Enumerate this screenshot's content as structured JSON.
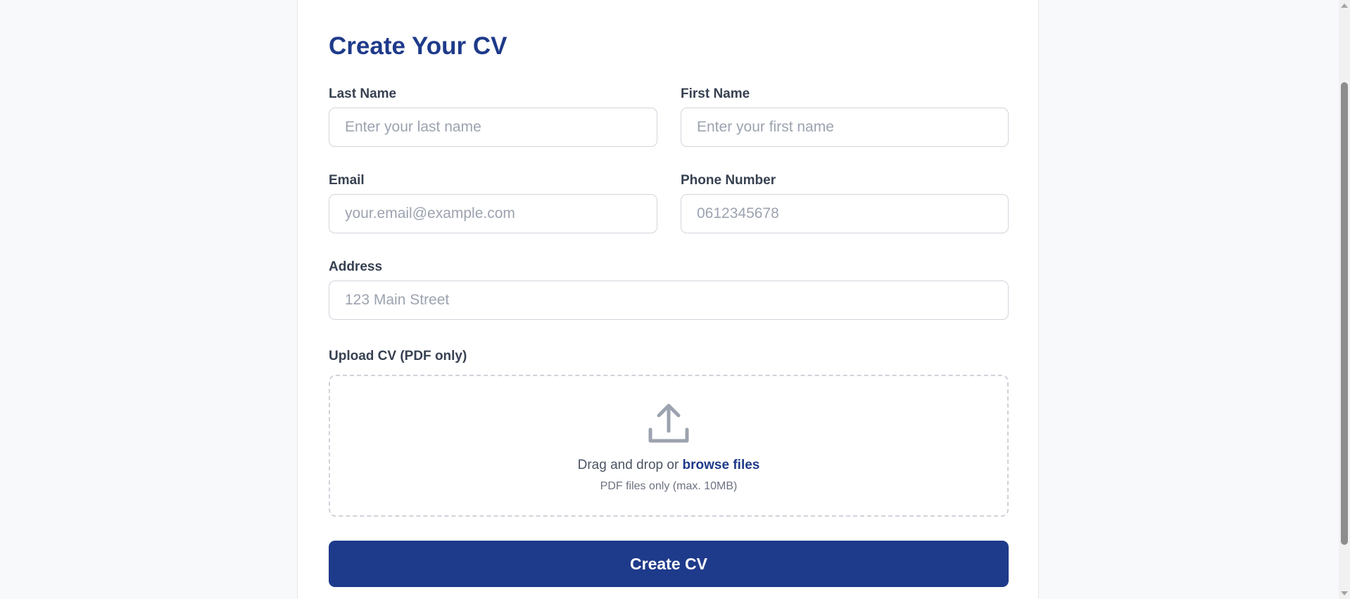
{
  "form": {
    "title": "Create Your CV",
    "last_name": {
      "label": "Last Name",
      "placeholder": "Enter your last name",
      "value": ""
    },
    "first_name": {
      "label": "First Name",
      "placeholder": "Enter your first name",
      "value": ""
    },
    "email": {
      "label": "Email",
      "placeholder": "your.email@example.com",
      "value": ""
    },
    "phone": {
      "label": "Phone Number",
      "placeholder": "0612345678",
      "value": ""
    },
    "address": {
      "label": "Address",
      "placeholder": "123 Main Street",
      "value": ""
    },
    "upload": {
      "label": "Upload CV (PDF only)",
      "icon": "upload-icon",
      "prompt": "Drag and drop or ",
      "browse_link": "browse files",
      "hint": "PDF files only (max. 10MB)"
    },
    "submit_label": "Create CV"
  },
  "colors": {
    "accent": "#1e3a8a",
    "background": "#f8f9fb",
    "card": "#ffffff",
    "border": "#d1d5db",
    "placeholder": "#9ca3af"
  }
}
